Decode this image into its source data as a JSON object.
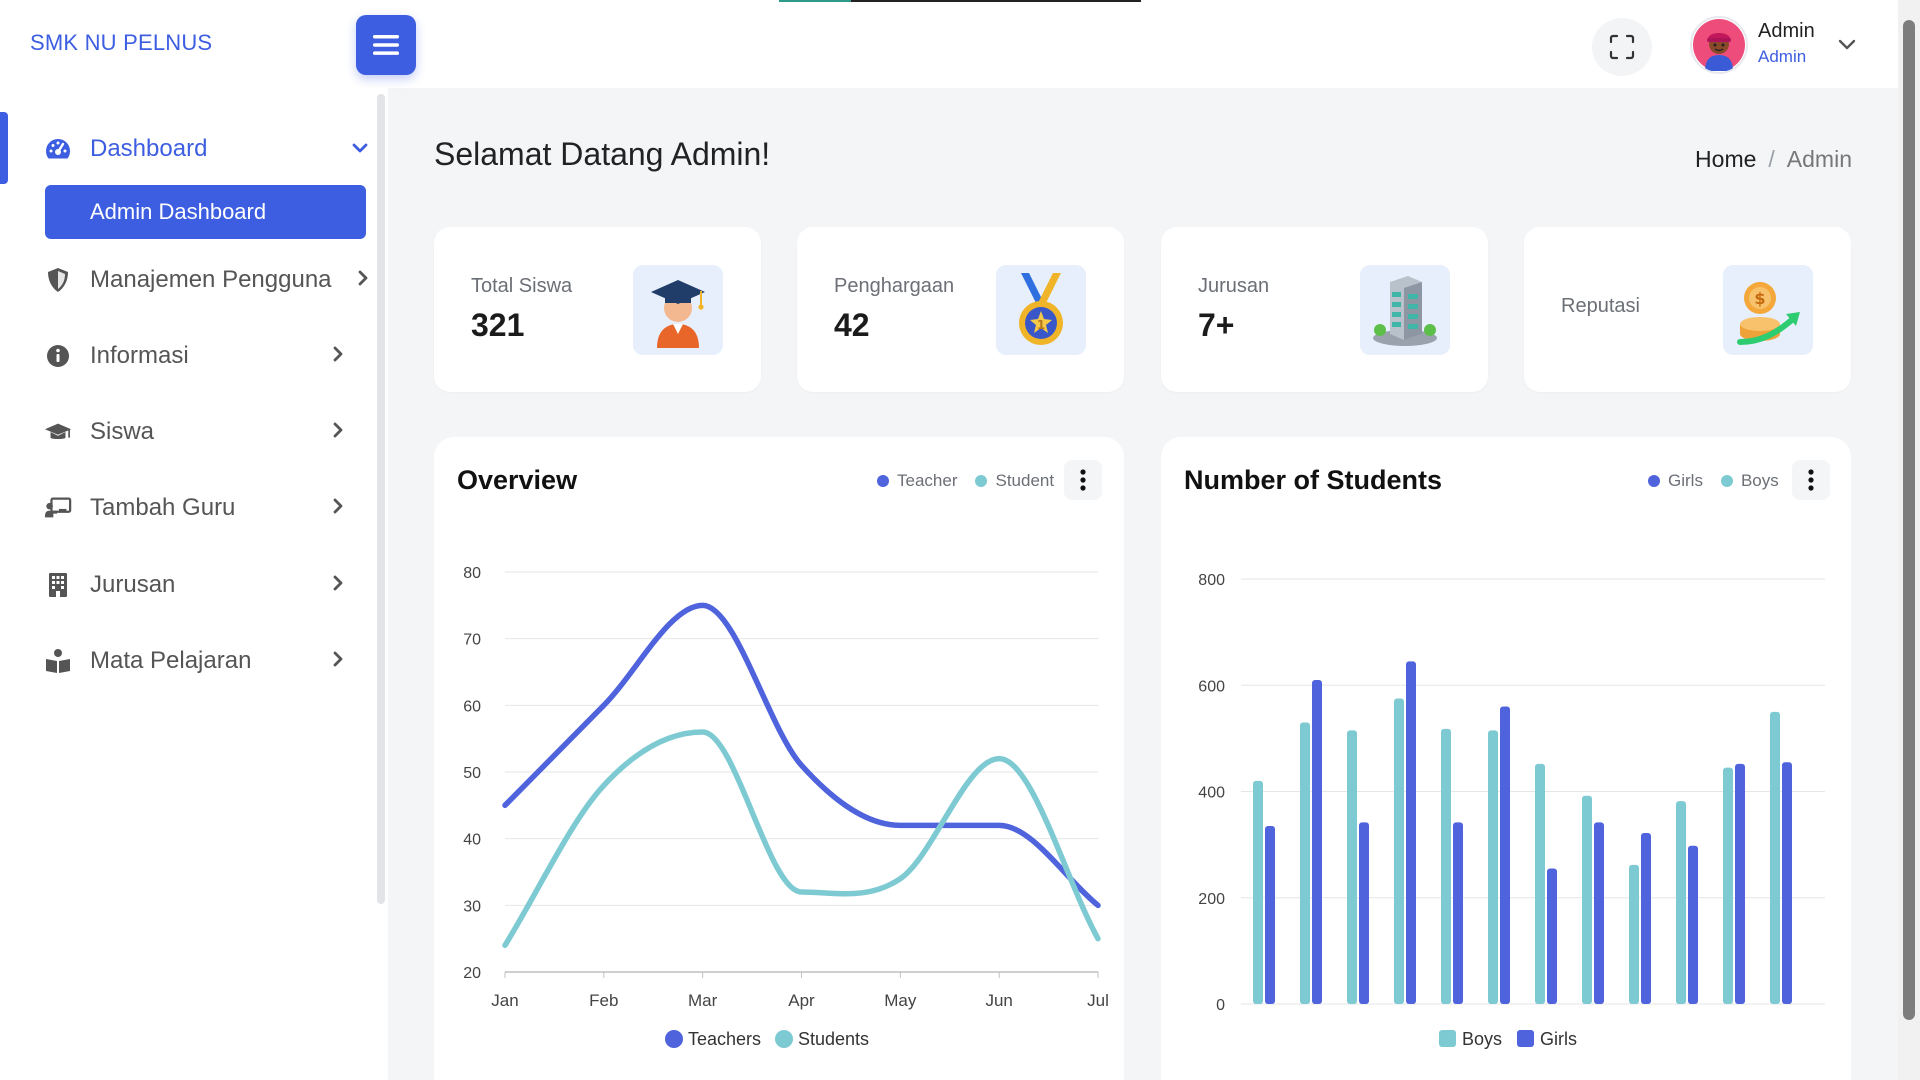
{
  "app": {
    "brand": "SMK NU PELNUS"
  },
  "header": {
    "user_name": "Admin",
    "user_role": "Admin"
  },
  "sidebar": {
    "items": [
      {
        "label": "Dashboard",
        "icon": "gauge-icon",
        "active": true,
        "expanded": true
      },
      {
        "label": "Manajemen Pengguna",
        "icon": "shield-icon"
      },
      {
        "label": "Informasi",
        "icon": "info-icon"
      },
      {
        "label": "Siswa",
        "icon": "graduation-cap-icon"
      },
      {
        "label": "Tambah Guru",
        "icon": "chalkboard-teacher-icon"
      },
      {
        "label": "Jurusan",
        "icon": "building-icon"
      },
      {
        "label": "Mata Pelajaran",
        "icon": "book-reader-icon"
      }
    ],
    "submenu_active": "Admin Dashboard"
  },
  "page": {
    "title": "Selamat Datang Admin!",
    "breadcrumb": {
      "home": "Home",
      "separator": "/",
      "current": "Admin"
    }
  },
  "stats": [
    {
      "label": "Total Siswa",
      "value": "321",
      "icon": "graduate-icon"
    },
    {
      "label": "Penghargaan",
      "value": "42",
      "icon": "medal-icon"
    },
    {
      "label": "Jurusan",
      "value": "7+",
      "icon": "building-icon"
    },
    {
      "label": "Reputasi",
      "value": "",
      "icon": "coin-growth-icon"
    }
  ],
  "colors": {
    "accent": "#3d5ee1",
    "teal": "#7ecad3",
    "blue_series": "#4f63dd"
  },
  "charts": {
    "overview": {
      "title": "Overview",
      "legend_top": [
        "Teacher",
        "Student"
      ],
      "legend_bottom": [
        "Teachers",
        "Students"
      ]
    },
    "students": {
      "title": "Number of Students",
      "legend_top": [
        "Girls",
        "Boys"
      ],
      "legend_bottom": [
        "Boys",
        "Girls"
      ]
    }
  },
  "chart_data": [
    {
      "type": "line",
      "title": "Overview",
      "categories": [
        "Jan",
        "Feb",
        "Mar",
        "Apr",
        "May",
        "Jun",
        "Jul"
      ],
      "series": [
        {
          "name": "Teachers",
          "values": [
            45,
            60,
            75,
            51,
            42,
            42,
            30
          ]
        },
        {
          "name": "Students",
          "values": [
            24,
            48,
            56,
            32,
            34,
            52,
            25
          ]
        }
      ],
      "yticks": [
        20,
        30,
        40,
        50,
        60,
        70,
        80
      ],
      "ylim": [
        20,
        80
      ],
      "grid": true,
      "legend": "bottom"
    },
    {
      "type": "bar",
      "title": "Number of Students",
      "groups": 12,
      "series": [
        {
          "name": "Boys",
          "values": [
            420,
            530,
            515,
            575,
            518,
            515,
            452,
            392,
            262,
            382,
            445,
            550
          ]
        },
        {
          "name": "Girls",
          "values": [
            335,
            610,
            342,
            645,
            342,
            560,
            255,
            342,
            322,
            298,
            452,
            455
          ]
        }
      ],
      "yticks": [
        0,
        200,
        400,
        600,
        800
      ],
      "ylim": [
        0,
        800
      ],
      "grid": true,
      "legend": "bottom"
    }
  ]
}
